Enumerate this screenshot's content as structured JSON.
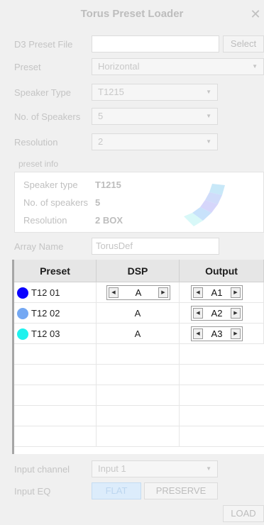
{
  "window": {
    "title": "Torus Preset Loader",
    "close_icon": "close-icon"
  },
  "form": {
    "d3_preset_file": {
      "label": "D3 Preset File",
      "value": "",
      "select_label": "Select"
    },
    "preset": {
      "label": "Preset",
      "value": "Horizontal"
    },
    "speaker_type": {
      "label": "Speaker Type",
      "value": "T1215"
    },
    "num_speakers": {
      "label": "No. of Speakers",
      "value": "5"
    },
    "resolution": {
      "label": "Resolution",
      "value": "2"
    }
  },
  "preset_info": {
    "heading": "preset info",
    "rows": [
      {
        "key": "Speaker type",
        "value": "T1215"
      },
      {
        "key": "No. of speakers",
        "value": "5"
      },
      {
        "key": "Resolution",
        "value": "2 BOX"
      }
    ]
  },
  "array_name": {
    "label": "Array Name",
    "value": "TorusDef"
  },
  "table": {
    "headers": [
      "Preset",
      "DSP",
      "Output"
    ],
    "rows": [
      {
        "preset": "T12 01",
        "color": "#0a00ff",
        "dsp": "A",
        "dsp_stepper": true,
        "output": "A1"
      },
      {
        "preset": "T12 02",
        "color": "#74a8f3",
        "dsp": "A",
        "dsp_stepper": false,
        "output": "A2"
      },
      {
        "preset": "T12 03",
        "color": "#1ef2ee",
        "dsp": "A",
        "dsp_stepper": false,
        "output": "A3"
      }
    ]
  },
  "input_channel": {
    "label": "Input channel",
    "value": "Input 1"
  },
  "input_eq": {
    "label": "Input EQ",
    "flat_label": "FLAT",
    "preserve_label": "PRESERVE"
  },
  "load_label": "LOAD",
  "colors": {
    "accent": "#0a00ff",
    "flat_bg": "#dcecfb"
  }
}
